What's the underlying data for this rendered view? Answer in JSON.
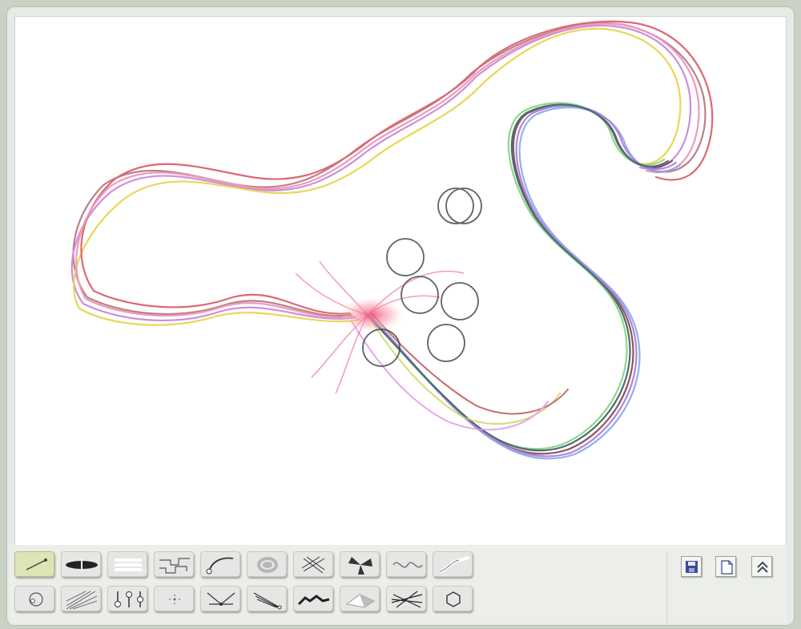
{
  "app": {
    "colors": {
      "canvas": "#ffffff",
      "frame": "#e8eae6",
      "active_tool": "#dfe4b7",
      "circle_stroke": "#4a4a4a"
    }
  },
  "tools": {
    "row1": [
      {
        "id": "line",
        "icon": "line-brush-icon",
        "active": true
      },
      {
        "id": "ellipse-stroke",
        "icon": "ellipse-brush-icon",
        "active": false
      },
      {
        "id": "parallel-lines",
        "icon": "parallel-lines-icon",
        "active": false
      },
      {
        "id": "circuit",
        "icon": "circuit-icon",
        "active": false
      },
      {
        "id": "curve",
        "icon": "curve-brush-icon",
        "active": false
      },
      {
        "id": "blur-ring",
        "icon": "blur-ring-icon",
        "active": false
      },
      {
        "id": "cross-hatch",
        "icon": "cross-hatch-icon",
        "active": false
      },
      {
        "id": "fan",
        "icon": "fan-brush-icon",
        "active": false
      },
      {
        "id": "wave",
        "icon": "wave-brush-icon",
        "active": false
      },
      {
        "id": "ribbon",
        "icon": "ribbon-brush-icon",
        "active": false
      }
    ],
    "row2": [
      {
        "id": "spiral",
        "icon": "spiral-brush-icon",
        "active": false
      },
      {
        "id": "web",
        "icon": "web-brush-icon",
        "active": false
      },
      {
        "id": "sliders",
        "icon": "sliders-brush-icon",
        "active": false
      },
      {
        "id": "dots",
        "icon": "dots-brush-icon",
        "active": false
      },
      {
        "id": "spring",
        "icon": "spring-brush-icon",
        "active": false
      },
      {
        "id": "rays",
        "icon": "rays-brush-icon",
        "active": false
      },
      {
        "id": "terrain",
        "icon": "terrain-brush-icon",
        "active": false
      },
      {
        "id": "shade",
        "icon": "shade-brush-icon",
        "active": false
      },
      {
        "id": "sticks",
        "icon": "sticks-brush-icon",
        "active": false
      },
      {
        "id": "hexagon",
        "icon": "hexagon-brush-icon",
        "active": false
      }
    ]
  },
  "actions": [
    {
      "id": "save",
      "icon": "floppy-disk-icon"
    },
    {
      "id": "new",
      "icon": "new-page-icon"
    },
    {
      "id": "collapse",
      "icon": "double-chevron-up-icon"
    }
  ]
}
